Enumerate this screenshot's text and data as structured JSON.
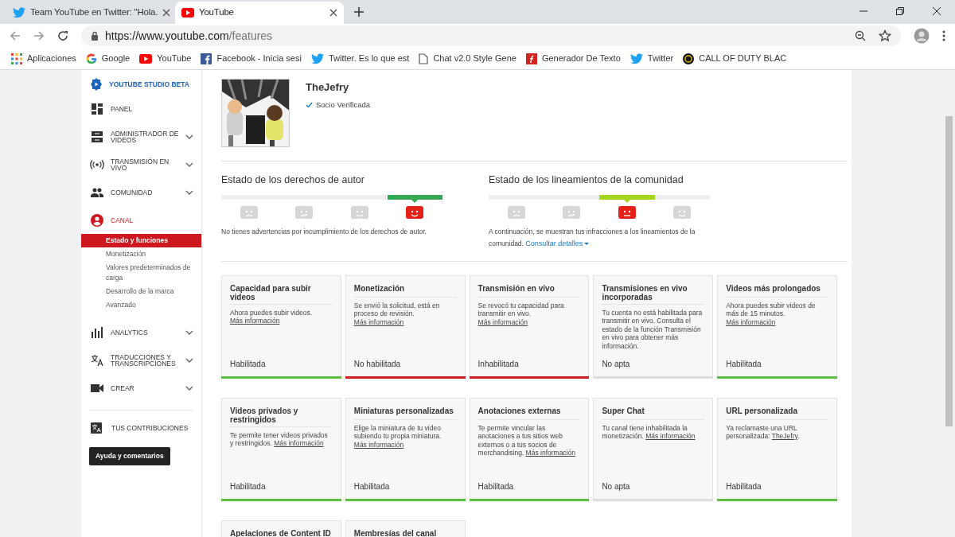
{
  "browser": {
    "tabs": [
      {
        "title": "Team YouTube en Twitter: \"Hola.",
        "selected": false
      },
      {
        "title": "YouTube",
        "selected": true
      }
    ],
    "url_host": "https://www.youtube.com",
    "url_path": "/features",
    "bookmarks": [
      {
        "label": "Aplicaciones"
      },
      {
        "label": "Google"
      },
      {
        "label": "YouTube"
      },
      {
        "label": "Facebook - Inicia sesi"
      },
      {
        "label": "Twitter. Es lo que est"
      },
      {
        "label": "Chat v2.0 Style Gene"
      },
      {
        "label": "Generador De Texto"
      },
      {
        "label": "Twitter"
      },
      {
        "label": "CALL OF DUTY BLAC"
      }
    ]
  },
  "sidebar": {
    "studio": "YOUTUBE STUDIO BETA",
    "items": [
      {
        "label": "PANEL",
        "expandable": false,
        "selected": false
      },
      {
        "label": "ADMINISTRADOR DE VIDEOS",
        "expandable": true,
        "selected": false
      },
      {
        "label": "TRANSMISIÓN EN VIVO",
        "expandable": true,
        "selected": false
      },
      {
        "label": "COMUNIDAD",
        "expandable": true,
        "selected": false
      },
      {
        "label": "CANAL",
        "expandable": false,
        "selected": true,
        "children": [
          {
            "label": "Estado y funciones",
            "selected": true
          },
          {
            "label": "Monetización",
            "selected": false
          },
          {
            "label": "Valores predeterminados de carga",
            "selected": false
          },
          {
            "label": "Desarrollo de la marca",
            "selected": false
          },
          {
            "label": "Avanzado",
            "selected": false
          }
        ]
      },
      {
        "label": "ANALYTICS",
        "expandable": true,
        "selected": false
      },
      {
        "label": "TRADUCCIONES Y TRANSCRIPCIONES",
        "expandable": true,
        "selected": false
      },
      {
        "label": "CREAR",
        "expandable": true,
        "selected": false
      }
    ],
    "contributions": "TUS CONTRIBUCIONES",
    "help_button": "Ayuda y comentarios"
  },
  "channel": {
    "name": "TheJefry",
    "badge": "Socio Verificada"
  },
  "statuses": [
    {
      "title": "Estado de los derechos de autor",
      "segments": [
        {
          "selected": false,
          "color": "#eeeeee"
        },
        {
          "selected": false,
          "color": "#eeeeee"
        },
        {
          "selected": false,
          "color": "#eeeeee"
        },
        {
          "selected": true,
          "color": "#34a853"
        }
      ],
      "text": "No tienes advertencias por incumplimiento de los derechos de autor."
    },
    {
      "title": "Estado de los lineamientos de la comunidad",
      "segments": [
        {
          "selected": false,
          "color": "#eeeeee"
        },
        {
          "selected": false,
          "color": "#eeeeee"
        },
        {
          "selected": true,
          "color": "#a5d51f"
        },
        {
          "selected": false,
          "color": "#eeeeee"
        }
      ],
      "text": "A continuación, se muestran tus infracciones a los lineamientos de la comunidad.",
      "link": "Consultar detalles"
    }
  ],
  "features": [
    {
      "title": "Capacidad para subir videos",
      "text": "Ahora puedes subir videos.",
      "link": "Más información",
      "status": "Habilitada",
      "color": "#5ac03d"
    },
    {
      "title": "Monetización",
      "text": "Se envió la solicitud, está en proceso de revisión.",
      "link": "Más información",
      "status": "No habilitada",
      "color": "#cc2020"
    },
    {
      "title": "Transmisión en vivo",
      "text": "Se revocó tu capacidad para transmitir en vivo.",
      "link": "Más información",
      "status": "Inhabilitada",
      "color": "#cc2020"
    },
    {
      "title": "Transmisiones en vivo incorporadas",
      "text": "Tu cuenta no está habilitada para transmitir en vivo. Consulta el estado de la función Transmisión en vivo para obtener más información.",
      "status": "No apta",
      "color": "#dddddd"
    },
    {
      "title": "Videos más prolongados",
      "text": "Ahora puedes subir videos de más de 15 minutos.",
      "link": "Más información",
      "status": "Habilitada",
      "color": "#5ac03d"
    },
    {
      "title": "Videos privados y restringidos",
      "text": "Te permite tener videos privados y restringidos.",
      "link": "Más información",
      "status": "Habilitada",
      "color": "#5ac03d"
    },
    {
      "title": "Miniaturas personalizadas",
      "text": "Elige la miniatura de tu video subiendo tu propia miniatura.",
      "link": "Más información",
      "status": "Habilitada",
      "color": "#5ac03d"
    },
    {
      "title": "Anotaciones externas",
      "text": "Te permite vincular las anotaciones a tus sitios web externos o a tus socios de merchandising.",
      "link": "Más información",
      "status": "Habilitada",
      "color": "#5ac03d"
    },
    {
      "title": "Super Chat",
      "text": "Tu canal tiene inhabilitada la monetización.",
      "link": "Más información",
      "status": "No apta",
      "color": "#dddddd"
    },
    {
      "title": "URL personalizada",
      "text": "Ya reclamaste una URL personalizada:",
      "link": "TheJefry",
      "after": ".",
      "status": "Habilitada",
      "color": "#5ac03d"
    },
    {
      "title": "Apelaciones de Content ID"
    },
    {
      "title": "Membresías del canal"
    }
  ]
}
